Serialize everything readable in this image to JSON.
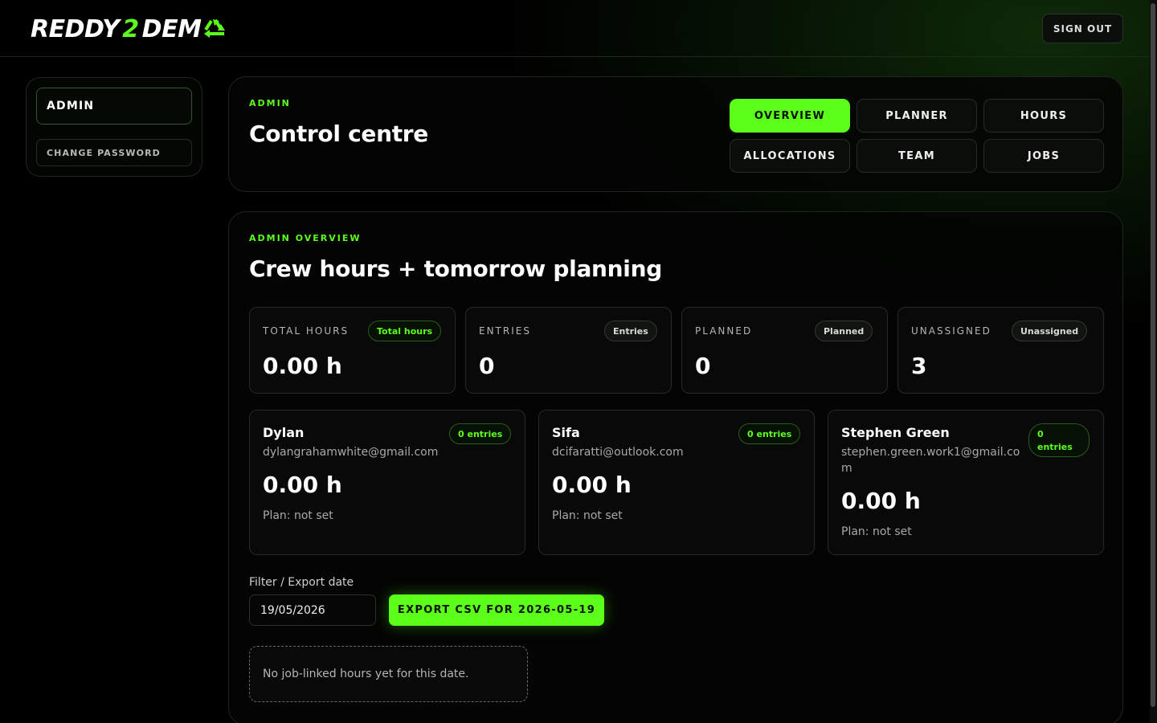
{
  "header": {
    "logo_part1": "REDDY",
    "logo_part2": "2",
    "logo_part3": "DEM",
    "sign_out_label": "SIGN OUT"
  },
  "sidebar": {
    "items": [
      {
        "label": "ADMIN"
      },
      {
        "label": "CHANGE PASSWORD"
      }
    ]
  },
  "control": {
    "eyebrow": "ADMIN",
    "title": "Control centre",
    "nav": [
      {
        "label": "OVERVIEW",
        "active": true
      },
      {
        "label": "PLANNER"
      },
      {
        "label": "HOURS"
      },
      {
        "label": "ALLOCATIONS"
      },
      {
        "label": "TEAM"
      },
      {
        "label": "JOBS"
      }
    ]
  },
  "overview": {
    "eyebrow": "ADMIN OVERVIEW",
    "title": "Crew hours + tomorrow planning",
    "stats": [
      {
        "label": "TOTAL HOURS",
        "pill": "Total hours",
        "value": "0.00 h"
      },
      {
        "label": "ENTRIES",
        "pill": "Entries",
        "value": "0"
      },
      {
        "label": "PLANNED",
        "pill": "Planned",
        "value": "0"
      },
      {
        "label": "UNASSIGNED",
        "pill": "Unassigned",
        "value": "3"
      }
    ],
    "crew": [
      {
        "name": "Dylan",
        "email": "dylangrahamwhite@gmail.com",
        "entries": "0 entries",
        "hours": "0.00 h",
        "plan": "Plan: not set"
      },
      {
        "name": "Sifa",
        "email": "dcifaratti@outlook.com",
        "entries": "0 entries",
        "hours": "0.00 h",
        "plan": "Plan: not set"
      },
      {
        "name": "Stephen Green",
        "email": "stephen.green.work1@gmail.com",
        "entries": "0 entries",
        "hours": "0.00 h",
        "plan": "Plan: not set"
      }
    ],
    "filter_label": "Filter / Export date",
    "date_value": "19/05/2026",
    "export_label": "EXPORT CSV FOR 2026-05-19",
    "empty_message": "No job-linked hours yet for this date."
  },
  "colors": {
    "accent": "#5cff1a",
    "background": "#000000"
  }
}
